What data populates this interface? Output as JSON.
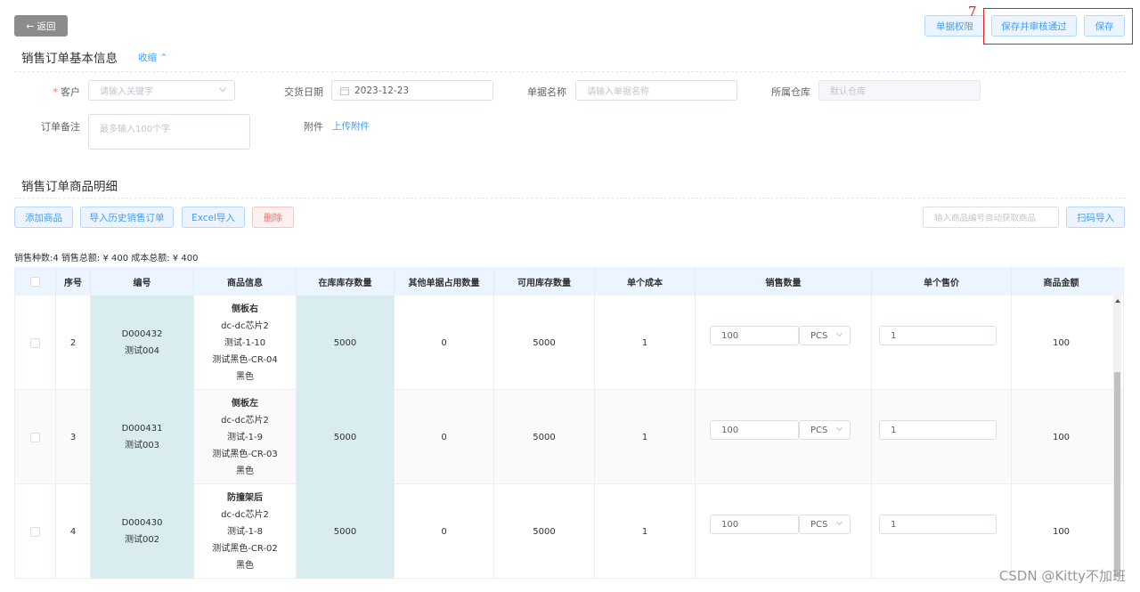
{
  "toolbar": {
    "back_label": "← 返回",
    "permission_label": "单据权限",
    "save_approve_label": "保存并审核通过",
    "save_label": "保存",
    "annotation_number": "7"
  },
  "basic_info": {
    "title": "销售订单基本信息",
    "collapse_label": "收缩 ⌃",
    "customer_label": "客户",
    "customer_required_mark": "*",
    "customer_placeholder": "请输入关键字",
    "delivery_date_label": "交货日期",
    "delivery_date_value": "2023-12-23",
    "doc_name_label": "单据名称",
    "doc_name_placeholder": "请输入单据名称",
    "warehouse_label": "所属仓库",
    "warehouse_value": "默认仓库",
    "remark_label": "订单备注",
    "remark_placeholder": "最多输入100个字",
    "attachment_label": "附件",
    "upload_label": "上传附件"
  },
  "detail": {
    "title": "销售订单商品明细",
    "add_label": "添加商品",
    "import_history_label": "导入历史销售订单",
    "excel_import_label": "Excel导入",
    "delete_label": "删除",
    "code_input_placeholder": "输入商品编号自动获取商品",
    "scan_import_label": "扫码导入",
    "stats": "销售种数:4   销售总额: ¥ 400   成本总额: ¥ 400"
  },
  "table": {
    "columns": [
      "",
      "序号",
      "编号",
      "商品信息",
      "在库库存数量",
      "其他单据占用数量",
      "可用库存数量",
      "单个成本",
      "销售数量",
      "单个售价",
      "商品金额"
    ],
    "rows": [
      {
        "seq": "2",
        "code": "D000432",
        "code_name": "测试004",
        "name": "侧板右",
        "spec1": "dc-dc芯片2",
        "spec2": "测试-1-10",
        "spec3": "测试黑色-CR-04",
        "color": "黑色",
        "stock": "5000",
        "occupied": "0",
        "available": "5000",
        "cost": "1",
        "qty": "100",
        "unit": "PCS",
        "price": "1",
        "amount": "100"
      },
      {
        "seq": "3",
        "code": "D000431",
        "code_name": "测试003",
        "name": "侧板左",
        "spec1": "dc-dc芯片2",
        "spec2": "测试-1-9",
        "spec3": "测试黑色-CR-03",
        "color": "黑色",
        "stock": "5000",
        "occupied": "0",
        "available": "5000",
        "cost": "1",
        "qty": "100",
        "unit": "PCS",
        "price": "1",
        "amount": "100"
      },
      {
        "seq": "4",
        "code": "D000430",
        "code_name": "测试002",
        "name": "防撞架后",
        "spec1": "dc-dc芯片2",
        "spec2": "测试-1-8",
        "spec3": "测试黑色-CR-02",
        "color": "黑色",
        "stock": "5000",
        "occupied": "0",
        "available": "5000",
        "cost": "1",
        "qty": "100",
        "unit": "PCS",
        "price": "1",
        "amount": "100"
      }
    ]
  },
  "watermark": "CSDN @Kitty不加班",
  "colors": {
    "primary": "#409eff",
    "danger": "#f56c6c",
    "annotation": "#e02020",
    "highlight_cell": "#d9edf0"
  }
}
